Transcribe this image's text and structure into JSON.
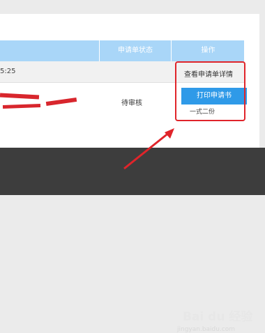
{
  "table": {
    "header": {
      "status": "申请单状态",
      "action": "操作"
    },
    "row1": {
      "time": "5:25",
      "view_detail": "查看申请单详情"
    },
    "row2": {
      "status": "待审核",
      "print_button": "打印申请书",
      "copies": "一式二份"
    }
  },
  "watermark": {
    "logo": "Bai du 经验",
    "url": "jingyan.baidu.com"
  },
  "colors": {
    "header_bg": "#a9d6f8",
    "button_bg": "#2f9ae8",
    "highlight": "#e0242a"
  }
}
